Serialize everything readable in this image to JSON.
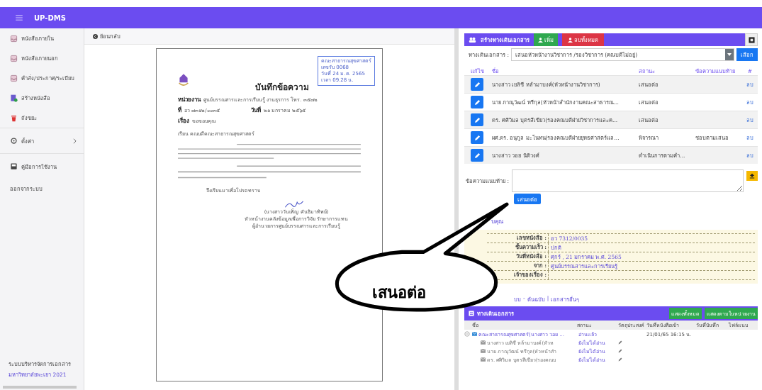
{
  "app": {
    "title": "UP-DMS"
  },
  "sidebar": {
    "items": [
      {
        "label": "หนังสือภายใน"
      },
      {
        "label": "หนังสือภายนอก"
      },
      {
        "label": "คำสั่ง/ประกาศ/ระเบียบ"
      },
      {
        "label": "สร้างหนังสือ"
      },
      {
        "label": "ถังขยะ"
      },
      {
        "label": "ตั้งค่า"
      },
      {
        "label": "คู่มือการใช้งาน"
      },
      {
        "label": "ออกจากระบบ"
      }
    ],
    "footer": {
      "line_1": "ระบบบริหารจัดการเอกสาร",
      "line_2": "มหาวิทยาลัยพะเยา 2021"
    }
  },
  "back_link": "ย้อนกลับ",
  "document": {
    "stamp": [
      "คณะสาธารณสุขศาสตร์",
      "เลขรับ 0068",
      "วันที่ 24 ม.ค. 2565",
      "เวลา 09.28 น."
    ],
    "title": "บันทึกข้อความ",
    "fields": [
      {
        "label": "หน่วยงาน",
        "value": "ศูนย์บรรณสารและการเรียนรู้ งานธุรการ โทร. ๓๕๗๒"
      },
      {
        "label": "ที่",
        "value": "อว ๗๓๑๒/๐๐๓๕",
        "date_label": "วันที่",
        "date_value": "๒๑ มกราคม ๒๕๖๕"
      },
      {
        "label": "เรื่อง",
        "value": "ขอขอบคุณ"
      }
    ],
    "salutation": "เรียน คณบดีคณะสาธารณสุขศาสตร์",
    "closing": "จึงเรียนมาเพื่อโปรดทราบ",
    "signer": [
      "(นางสาววันเพ็ญ คันธิมาทิพย์)",
      "หัวหน้างานคลังข้อมูลเพื่อการวิจัย รักษาการแทน",
      "ผู้อำนวยการศูนย์บรรณสารและการเรียนรู้"
    ]
  },
  "route_panel": {
    "title": "สร้างทางเดินเอกสาร",
    "add_button": "เพิ่ม",
    "delete_all_button": "ลบทั้งหมด",
    "route_label": "ทางเดินเอกสาร :",
    "route_value": "เสนอหัวหน้างานวิชาการ /รองวิชาการ (คณบดีไม่อยู่)",
    "choose_button": "เลือก",
    "columns": [
      "แก้ไข",
      "ชื่อ",
      "สถานะ",
      "ข้อความแนบท้าย",
      "#"
    ],
    "rows": [
      {
        "name": "นางสาว เยลิชี หล้ามาบงค์(หัวหน้างานวิชาการ)",
        "status": "เสนอต่อ",
        "action": "ลบ"
      },
      {
        "name": "นาย ภาณุวัฒน์ ทรีกุล(หัวหน้าสำนักงานคณะสาธารณ...",
        "status": "เสนอต่อ",
        "action": "ลบ"
      },
      {
        "name": "ดร. ศศิวิมล บุตรสีเขียว(รองคณบดีฝ่ายวิชาการและค...",
        "status": "เสนอต่อ",
        "action": "ลบ"
      },
      {
        "name": "ผศ.ดร. อนุกูล มะโนทน(รองคณบดีฝ่ายยุทธศาสตร์แล...",
        "status": "พิจารณา",
        "note": "ชอบตามเสนอ",
        "action": "ลบ"
      },
      {
        "name": "นางสาว วอย นิติวงศ์",
        "status": "ดำเนินการตามคำ...",
        "action": "ลบ"
      }
    ],
    "comment_label": "ข้อความแนบท้าย :",
    "submit_button": "เสนอต่อ",
    "subject_link": "บคุณ"
  },
  "info": [
    {
      "label": "เลขหนังสือ :",
      "value": "อว 7312/0035"
    },
    {
      "label": "ชั้นความเร็ว :",
      "value": "ปกติ"
    },
    {
      "label": "วันที่หนังสือ :",
      "value": "ศุกร์ , 21 มกราคม พ.ศ. 2565"
    },
    {
      "label": "จาก :",
      "value": "ศูนย์บรรณสารและการเรียนรู้"
    },
    {
      "label": "เจ้าของเรื่อง :"
    }
  ],
  "file_links": {
    "cut": "บบ",
    "dash": "-",
    "original": "ต้นฉบับ",
    "bar": "|",
    "other": "เอกสารอื่นๆ"
  },
  "history": {
    "title": "ทางเดินเอกสาร",
    "show_all_button": "แสดงทั้งหมด",
    "show_unit_button": "แสดงตามในหน่วยงาน",
    "columns": [
      "ชื่อ",
      "สถานะ",
      "วัตถุประสงค์",
      "วันที่หนังสือเข้า",
      "วันที่บันทึก",
      "ไฟล์แนบ"
    ],
    "tree": [
      {
        "name": "คณะสาธารณสุขศาสตร์(นางสาว วอย ...",
        "status": "อ่านแล้ว",
        "date": "21/01/65 16:15 น.",
        "expanded": true,
        "children": [
          {
            "name": "นางสาว เยลิชี หล้ามาบงค์(หัวห",
            "status": "ยังไม่ได้อ่าน"
          },
          {
            "name": "นาย ภาณุวัฒน์ ทรีกุล(หัวหน้าสำ",
            "status": "ยังไม่ได้อ่าน"
          },
          {
            "name": "ดร. ศศิวิมล บุตรสีเขียว(รองคณบ",
            "status": "ยังไม่ได้อ่าน"
          }
        ]
      }
    ]
  },
  "callout": {
    "text": "เสนอต่อ"
  }
}
